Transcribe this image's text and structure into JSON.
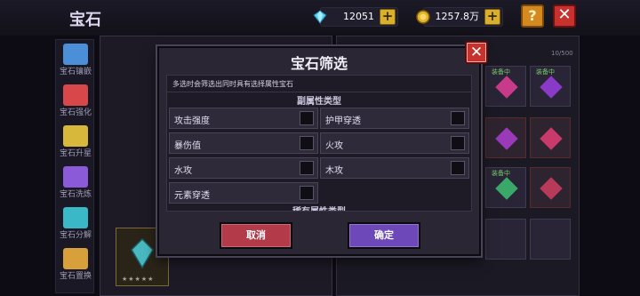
{
  "header": {
    "title": "宝石",
    "gems": "12051",
    "gold": "1257.8万",
    "help": "?",
    "close": "✕"
  },
  "sidebar": {
    "items": [
      {
        "label": "宝石镶嵌",
        "color": "#4a8fd8"
      },
      {
        "label": "宝石强化",
        "color": "#d8484a"
      },
      {
        "label": "宝石升星",
        "color": "#d8b83a"
      },
      {
        "label": "宝石洗炼",
        "color": "#8a5ad8"
      },
      {
        "label": "宝石分解",
        "color": "#3ab8c8"
      },
      {
        "label": "宝石置换",
        "color": "#d8a03a"
      }
    ]
  },
  "background": {
    "counter": "10/500",
    "slot_tag": "装备中",
    "stars": "★★★★★"
  },
  "modal": {
    "title": "宝石筛选",
    "close": "✕",
    "hint": "多选时会筛选出同时具有选择属性宝石",
    "section_title": "副属性类型",
    "options": [
      {
        "label": "攻击强度",
        "checked": false
      },
      {
        "label": "护甲穿透",
        "checked": false
      },
      {
        "label": "暴伤值",
        "checked": false
      },
      {
        "label": "火攻",
        "checked": false
      },
      {
        "label": "水攻",
        "checked": false
      },
      {
        "label": "木攻",
        "checked": false
      },
      {
        "label": "元素穿透",
        "checked": false
      }
    ],
    "next_section": "稀有属性类型",
    "cancel": "取消",
    "confirm": "确定"
  },
  "colors": {
    "accent_red": "#c7322e",
    "accent_purple": "#6c48b8",
    "gold": "#d8b02c"
  }
}
